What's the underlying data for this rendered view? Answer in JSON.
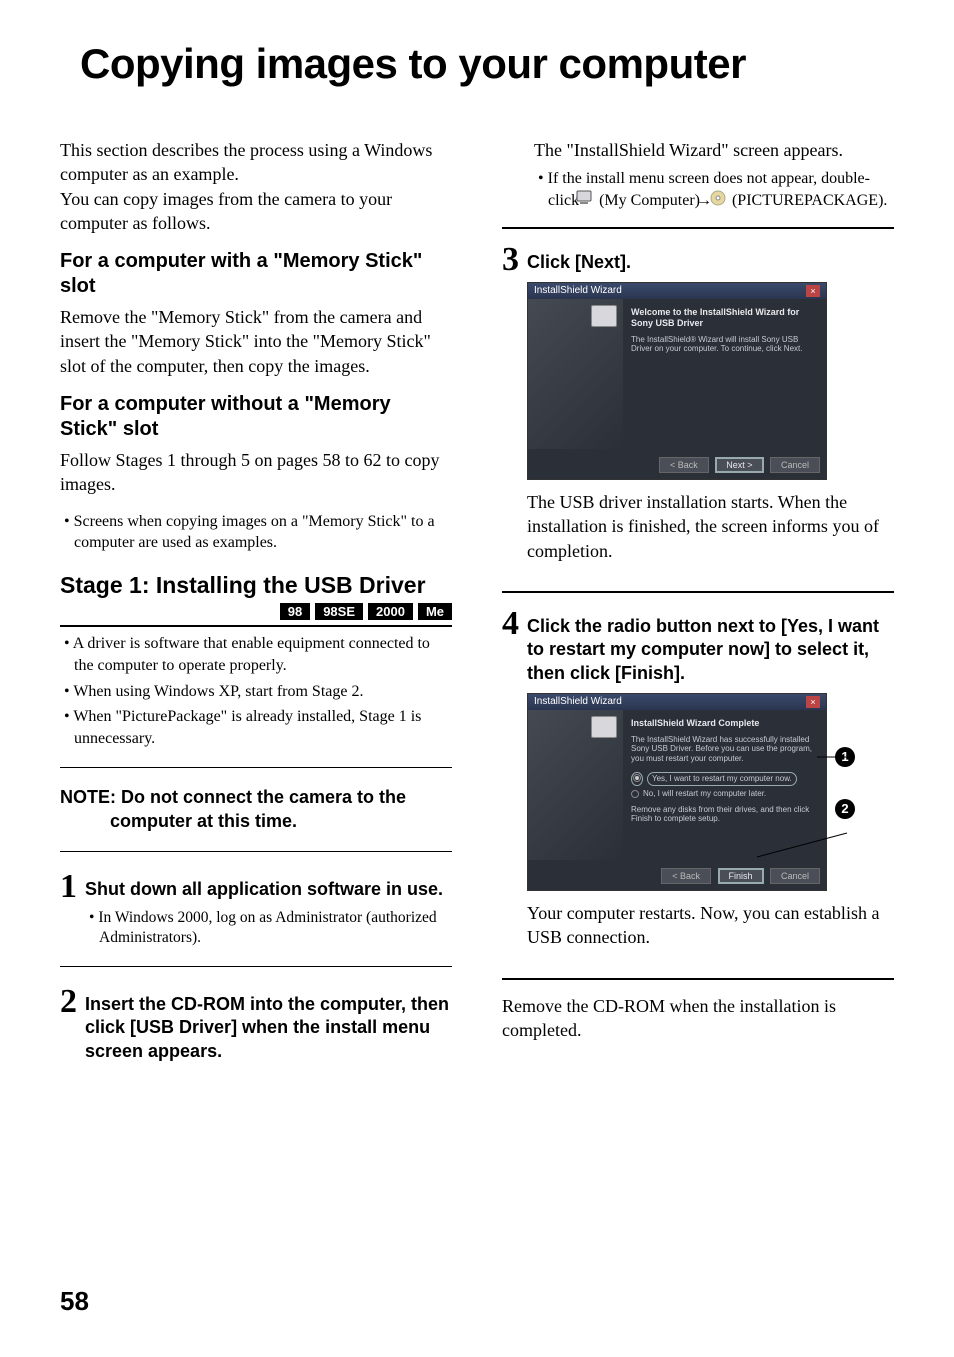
{
  "page": {
    "title": "Copying images to your computer",
    "number": "58"
  },
  "left": {
    "intro1": "This section describes the process using a Windows computer as an example.",
    "intro2": "You can copy images from the camera to your computer as follows.",
    "h1": "For a computer with a \"Memory Stick\" slot",
    "p1": "Remove the \"Memory Stick\" from the camera and insert the \"Memory Stick\" into the \"Memory Stick\" slot of the computer, then copy the images.",
    "h2": "For a computer without a \"Memory Stick\" slot",
    "p2": "Follow Stages 1 through 5 on pages 58 to 62 to copy images.",
    "b1": "Screens when copying images on a \"Memory Stick\" to a computer are used as examples.",
    "stage_title": "Stage 1: Installing the USB Driver",
    "os": [
      "98",
      "98SE",
      "2000",
      "Me"
    ],
    "sb1": "A driver is software that enable equipment connected to the computer to operate properly.",
    "sb2": "When using Windows XP, start from Stage 2.",
    "sb3": "When \"PicturePackage\" is already installed, Stage 1 is unnecessary.",
    "note": "NOTE: Do not connect the camera to the computer at this time.",
    "step1_num": "1",
    "step1_title": "Shut down all application software in use.",
    "step1_sub": "In Windows 2000, log on as Administrator (authorized Administrators).",
    "step2_num": "2",
    "step2_title": "Insert the CD-ROM into the computer, then click [USB Driver] when the install menu screen appears."
  },
  "right": {
    "p1": "The \"InstallShield Wizard\" screen appears.",
    "b1_a": "If the install menu screen does not appear, double-click ",
    "b1_b": " (My Computer) ",
    "b1_c": " (PICTUREPACKAGE).",
    "step3_num": "3",
    "step3_title": "Click [Next].",
    "dlg1": {
      "title": "InstallShield Wizard",
      "heading": "Welcome to the InstallShield Wizard for Sony USB Driver",
      "body": "The InstallShield® Wizard will install Sony USB Driver on your computer. To continue, click Next.",
      "back": "< Back",
      "next": "Next >",
      "cancel": "Cancel"
    },
    "p3a": "The USB driver installation starts. When the installation is finished, the screen informs you of completion.",
    "step4_num": "4",
    "step4_title": "Click the radio button next to [Yes, I want to restart my computer now] to select it, then click [Finish].",
    "dlg2": {
      "title": "InstallShield Wizard",
      "heading": "InstallShield Wizard Complete",
      "body1": "The InstallShield Wizard has successfully installed Sony USB Driver. Before you can use the program, you must restart your computer.",
      "opt1": "Yes, I want to restart my computer now.",
      "opt2": "No, I will restart my computer later.",
      "body2": "Remove any disks from their drives, and then click Finish to complete setup.",
      "back": "< Back",
      "finish": "Finish",
      "cancel": "Cancel"
    },
    "callout1": "1",
    "callout2": "2",
    "p4": "Your computer restarts. Now, you can establish a USB connection.",
    "p5": "Remove the CD-ROM when the installation is completed."
  }
}
